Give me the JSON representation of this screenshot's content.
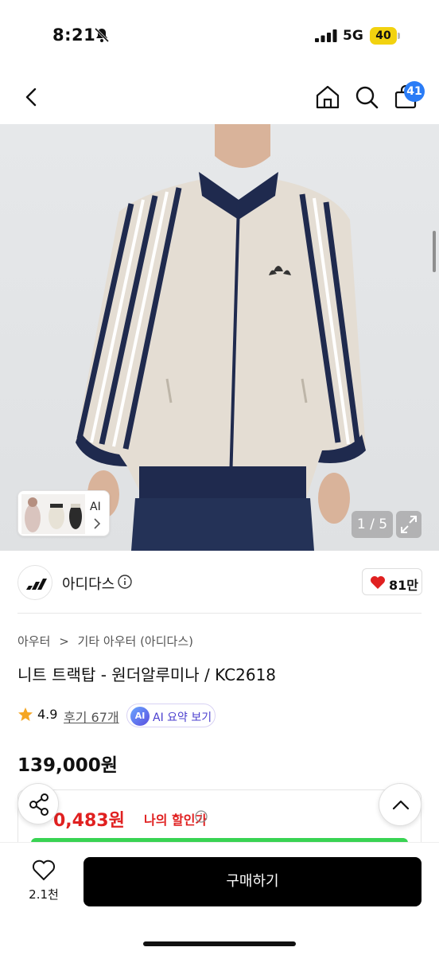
{
  "status_bar": {
    "time": "8:21",
    "network": "5G",
    "battery": "40"
  },
  "nav": {
    "cart_count": "41"
  },
  "gallery": {
    "counter": "1 / 5",
    "thumb_ai_label": "AI"
  },
  "brand": {
    "name": "아디다스",
    "likes": "81만"
  },
  "breadcrumb": {
    "level1": "아우터",
    "separator": ">",
    "level2": "기타 아우터 (아디다스)"
  },
  "product": {
    "title": "니트 트랙탑 - 원더알루미나 / KC2618",
    "rating": "4.9",
    "reviews": "후기 67개",
    "ai_summary": "AI 요약 보기",
    "price": "139,000원"
  },
  "discount": {
    "price": "0,483원",
    "label": "나의 할인가"
  },
  "bottom_bar": {
    "wish_count": "2.1천",
    "buy_label": "구매하기"
  },
  "colors": {
    "accent_blue": "#2a7cf6",
    "discount_red": "#e02020",
    "green_bar": "#39d353",
    "jacket_navy": "#1f2a4e",
    "jacket_cream": "#e4ddd3"
  }
}
